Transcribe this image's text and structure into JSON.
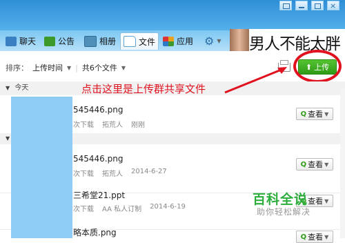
{
  "window": {
    "controls": [
      "minimize-icon",
      "maximize-icon",
      "close-icon",
      "settings-icon"
    ]
  },
  "nav": {
    "tabs": [
      {
        "label": "聊天",
        "icon": "chat-icon"
      },
      {
        "label": "公告",
        "icon": "announcement-icon"
      },
      {
        "label": "相册",
        "icon": "album-icon"
      },
      {
        "label": "文件",
        "icon": "folder-icon",
        "active": true
      },
      {
        "label": "应用",
        "icon": "apps-icon"
      }
    ],
    "gear_icon": "gear-icon",
    "banner_text": "男人不能太胖"
  },
  "toolbar": {
    "sort_label": "排序：",
    "sort_value": "上传时间",
    "count_value": "共6个文件",
    "upload_label": "上传",
    "tray_icon": "inbox-icon"
  },
  "annotation": "点击这里是上传群共享文件",
  "sections": [
    {
      "label": "今天"
    },
    {
      "label": ""
    }
  ],
  "files": [
    {
      "name": "545446.png",
      "downloads": "次下载",
      "uploader": "拓荒人",
      "time": "刚刚",
      "action": "查看"
    },
    {
      "name": "545446.png",
      "downloads": "次下载",
      "uploader": "拓荒人",
      "time": "2014-6-27",
      "action": "查看"
    },
    {
      "name": "三希堂21.ppt",
      "downloads": "次下载",
      "uploader": "AA 私人订制",
      "time": "2014-6-19",
      "action": "查看"
    },
    {
      "name": "略本质.png",
      "downloads": "",
      "uploader": "",
      "time": "",
      "action": "查看"
    }
  ],
  "watermark": {
    "title": "百科全说",
    "subtitle": "助你轻松解决"
  },
  "colors": {
    "accent_green": "#2e9a16",
    "annotation_red": "#e0121f",
    "title_blue": "#2f8fd6"
  }
}
